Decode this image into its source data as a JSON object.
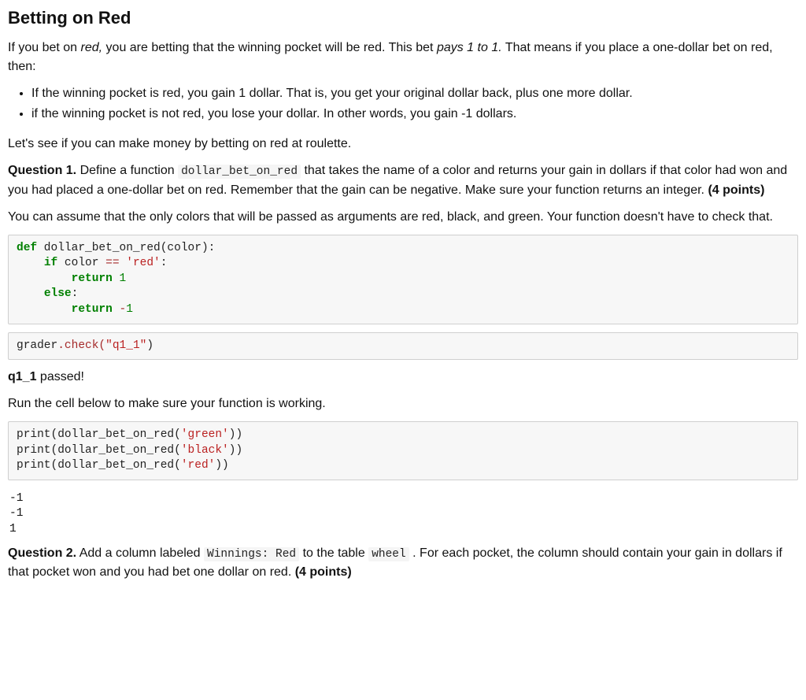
{
  "title": "Betting on Red",
  "intro_p1_a": "If you bet on ",
  "intro_p1_red": "red,",
  "intro_p1_b": " you are betting that the winning pocket will be red. This bet ",
  "intro_p1_pays": "pays 1 to 1.",
  "intro_p1_c": " That means if you place a one-dollar bet on red, then:",
  "bullet1": "If the winning pocket is red, you gain 1 dollar. That is, you get your original dollar back, plus one more dollar.",
  "bullet2": "if the winning pocket is not red, you lose your dollar. In other words, you gain -1 dollars.",
  "lets_see": "Let's see if you can make money by betting on red at roulette.",
  "q1_label": "Question 1.",
  "q1_a": " Define a function ",
  "q1_code": "dollar_bet_on_red",
  "q1_b": " that takes the name of a color and returns your gain in dollars if that color had won and you had placed a one-dollar bet on red. Remember that the gain can be negative. Make sure your function returns an integer. ",
  "q1_points": "(4 points)",
  "q1_note": "You can assume that the only colors that will be passed as arguments are red, black, and green. Your function doesn't have to check that.",
  "code1": {
    "def": "def",
    "funcname": " dollar_bet_on_red(color):",
    "if": "if",
    "cond_a": " color ",
    "eq": "==",
    "cond_b": " ",
    "red": "'red'",
    "colon": ":",
    "return1": "return",
    "one": " 1",
    "else": "else",
    "return2": "return",
    "minus": " -",
    "oneNeg": "1"
  },
  "code2_a": "grader",
  "code2_b": ".check(",
  "code2_str": "\"q1_1\"",
  "code2_c": ")",
  "passed_a": "q1_1",
  "passed_b": " passed!",
  "run_below": "Run the cell below to make sure your function is working.",
  "code3": {
    "l1a": "print(dollar_bet_on_red(",
    "l1s": "'green'",
    "l1b": "))",
    "l2a": "print(dollar_bet_on_red(",
    "l2s": "'black'",
    "l2b": "))",
    "l3a": "print(dollar_bet_on_red(",
    "l3s": "'red'",
    "l3b": "))"
  },
  "output3": "-1\n-1\n1",
  "q2_label": "Question 2.",
  "q2_a": " Add a column labeled ",
  "q2_code1": "Winnings: Red",
  "q2_b": " to the table ",
  "q2_code2": "wheel",
  "q2_c": " . For each pocket, the column should contain your gain in dollars if that pocket won and you had bet one dollar on red. ",
  "q2_points": "(4 points)"
}
